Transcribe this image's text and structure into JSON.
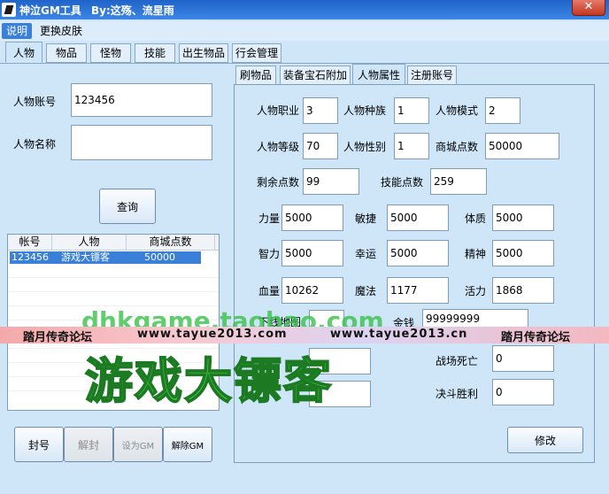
{
  "window": {
    "title": "神泣GM工具",
    "author": "By:这殇、流星雨",
    "close_glyph": "✕"
  },
  "menu": [
    "说明",
    "更换皮肤"
  ],
  "main_tabs": [
    "人物",
    "物品",
    "怪物",
    "技能",
    "出生物品",
    "行会管理"
  ],
  "left": {
    "account_label": "人物账号",
    "account_value": "123456",
    "name_label": "人物名称",
    "name_value": "",
    "query_button": "查询",
    "list": {
      "columns": [
        "帐号",
        "人物",
        "商城点数"
      ],
      "rows": [
        {
          "account": "123456",
          "name": "游戏大镖客",
          "points": "50000"
        }
      ]
    },
    "buttons": {
      "ban": "封号",
      "unban": "解封",
      "set_gm": "设为GM",
      "remove_gm": "解除GM"
    }
  },
  "sub_tabs": [
    "刷物品",
    "装备宝石附加",
    "人物属性",
    "注册账号"
  ],
  "attrs": {
    "job_label": "人物职业",
    "job": "3",
    "race_label": "人物种族",
    "race": "1",
    "mode_label": "人物模式",
    "mode": "2",
    "level_label": "人物等级",
    "level": "70",
    "gender_label": "人物性别",
    "gender": "1",
    "mall_label": "商城点数",
    "mall": "50000",
    "remain_label": "剩余点数",
    "remain": "99",
    "skillpts_label": "技能点数",
    "skillpts": "259",
    "str_label": "力量",
    "str": "5000",
    "dex_label": "敏捷",
    "dex": "5000",
    "con_label": "体质",
    "con": "5000",
    "int_label": "智力",
    "int": "5000",
    "luck_label": "幸运",
    "luck": "5000",
    "spirit_label": "精神",
    "spirit": "5000",
    "hp_label": "血量",
    "hp": "10262",
    "mp_label": "魔法",
    "mp": "1177",
    "vit_label": "活力",
    "vit": "1868",
    "logout_map_label": "下线地图",
    "logout_map": "",
    "gold_label": "金钱",
    "gold": "99999999",
    "field_a": "",
    "field_b": "",
    "battle_death_label": "战场死亡",
    "battle_death": "0",
    "duel_win_label": "决斗胜利",
    "duel_win": "0",
    "modify_button": "修改"
  },
  "overlay": {
    "banner_left": "踏月传奇论坛",
    "banner_url_1": "www.tayue2013.com",
    "banner_url_2": "www.tayue2013.cn",
    "banner_right": "踏月传奇论坛",
    "watermark_top": "dhkgame.taobao.com",
    "watermark_big": "游戏大镖客"
  }
}
